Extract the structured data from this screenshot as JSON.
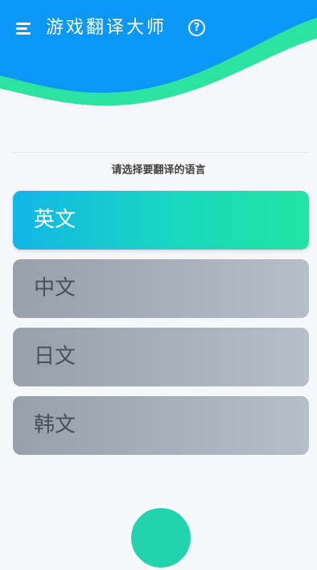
{
  "header": {
    "title": "游戏翻译大师",
    "menu_icon": "menu-icon",
    "help_icon": "help-circle-icon",
    "help_glyph": "?"
  },
  "main": {
    "prompt": "请选择要翻译的语言",
    "languages": [
      {
        "label": "英文",
        "selected": true
      },
      {
        "label": "中文",
        "selected": false
      },
      {
        "label": "日文",
        "selected": false
      },
      {
        "label": "韩文",
        "selected": false
      }
    ]
  },
  "colors": {
    "header_blue": "#0a97f5",
    "header_green": "#2de3a2",
    "selected_start": "#12b6e6",
    "selected_end": "#22e4a2",
    "unselected": "#a8b0ba"
  }
}
